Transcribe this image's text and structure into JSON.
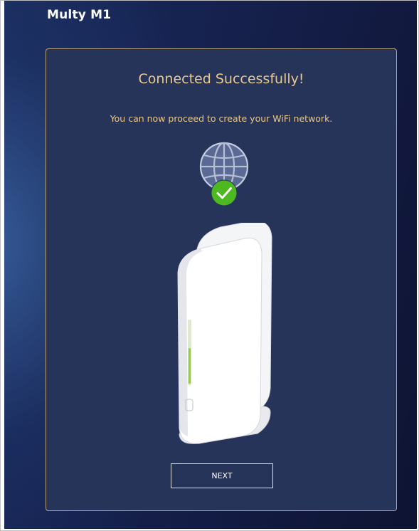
{
  "app": {
    "brand": "Multy M1"
  },
  "card": {
    "title": "Connected Successfully!",
    "subtitle": "You can now proceed to create your WiFi network.",
    "next_label": "NEXT"
  },
  "icons": {
    "globe": "globe-icon",
    "check": "check-circle-icon",
    "device": "router-device-illustration"
  },
  "colors": {
    "accent_gold": "#e8c88c",
    "card_bg": "#26345a",
    "success_green": "#4db81f",
    "led_green": "#8fd42a"
  }
}
